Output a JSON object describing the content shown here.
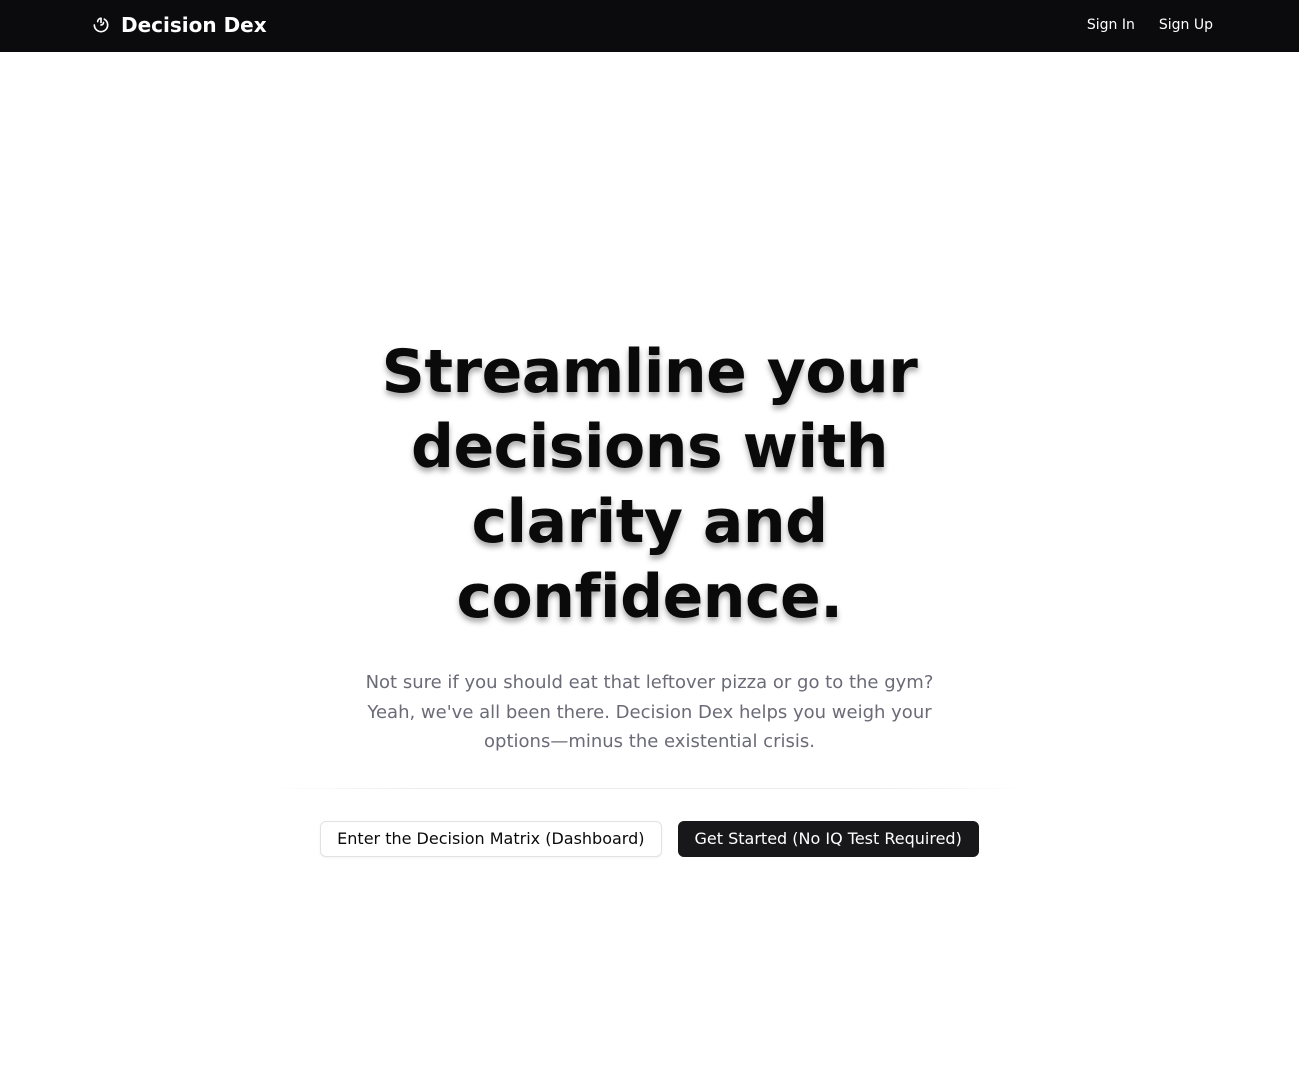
{
  "navbar": {
    "brand_icon": "brain-icon",
    "brand_name": "Decision Dex",
    "links": [
      {
        "label": "Sign In"
      },
      {
        "label": "Sign Up"
      }
    ],
    "background": "#0b0b0d"
  },
  "hero": {
    "title": "Streamline your decisions with clarity and confidence.",
    "subtitle": "Not sure if you should eat that leftover pizza or go to the gym? Yeah, we've all been there. Decision Dex helps you weigh your options—minus the existential crisis.",
    "buttons": {
      "secondary_label": "Enter the Decision Matrix (Dashboard)",
      "primary_label": "Get Started (No IQ Test Required)"
    }
  },
  "colors": {
    "title": "#0a0a0a",
    "subtitle": "#6b6b78",
    "primary_button": "#18181b"
  }
}
